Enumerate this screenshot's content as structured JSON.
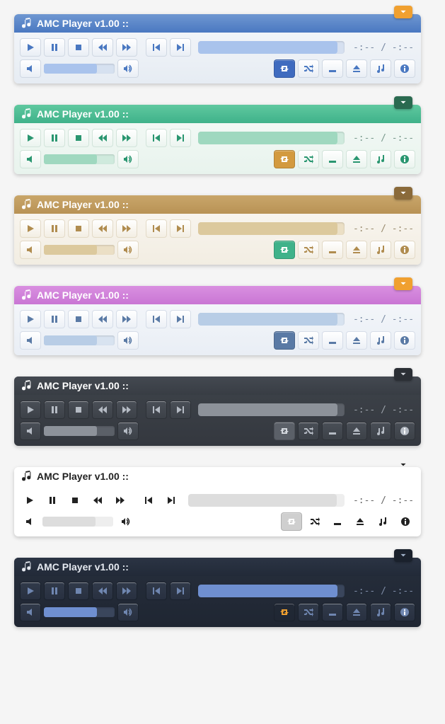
{
  "playerTitle": "AMC Player v1.00 ::",
  "time": "-:-- / -:--",
  "progressPercent": 95,
  "volumePercent": 75,
  "themes": [
    {
      "name": "blue",
      "titlebarBg": "linear-gradient(#6f97d1,#4a78c1)",
      "titlebarColor": "#ffffff",
      "bodyBg": "linear-gradient(#f5f7fa,#e6ecf3)",
      "btnBg": "linear-gradient(#ffffff,#e9eef5)",
      "btnBorder": "#d0d8e3",
      "iconColor": "#4a78c1",
      "progressBg": "#d6e0f0",
      "progressFill": "#a9c3ec",
      "volumeBg": "#d6e1f0",
      "volumeFill": "#a9c3ec",
      "timeColor": "#7a8aa3",
      "collapseBg": "#f0a030",
      "collapseIcon": "#ffffff",
      "repeatBg": "#3f6bbf",
      "repeatIcon": "#ffffff"
    },
    {
      "name": "green",
      "titlebarBg": "linear-gradient(#5fc89f,#3fb28a)",
      "titlebarColor": "#ffffff",
      "bodyBg": "linear-gradient(#f5faf7,#e8f3ed)",
      "btnBg": "linear-gradient(#ffffff,#ebf4ef)",
      "btnBorder": "#d2e4da",
      "iconColor": "#2a9670",
      "progressBg": "#cfeadd",
      "progressFill": "#9fd8bf",
      "volumeBg": "#cfeadd",
      "volumeFill": "#9fd8bf",
      "timeColor": "#7a9a8d",
      "collapseBg": "#2a6a50",
      "collapseIcon": "#ffffff",
      "repeatBg": "#d39a3f",
      "repeatIcon": "#ffffff"
    },
    {
      "name": "tan",
      "titlebarBg": "linear-gradient(#c9a66a,#b89255)",
      "titlebarColor": "#ffffff",
      "bodyBg": "linear-gradient(#faf7f2,#f2ede2)",
      "btnBg": "linear-gradient(#ffffff,#f3eee3)",
      "btnBorder": "#e3dac7",
      "iconColor": "#b08c4f",
      "progressBg": "#ebdfc5",
      "progressFill": "#dcc99d",
      "volumeBg": "#ebdfc5",
      "volumeFill": "#dcc99d",
      "timeColor": "#9a8c70",
      "collapseBg": "#8a6a3a",
      "collapseIcon": "#ffffff",
      "repeatBg": "#3fb28a",
      "repeatIcon": "#ffffff"
    },
    {
      "name": "purple",
      "titlebarBg": "linear-gradient(#d98fe0,#c976d4)",
      "titlebarColor": "#ffffff",
      "bodyBg": "linear-gradient(#f6f8fb,#e9eef5)",
      "btnBg": "linear-gradient(#ffffff,#ecf0f6)",
      "btnBorder": "#d6dde8",
      "iconColor": "#5a7aa5",
      "progressBg": "#d8e3f0",
      "progressFill": "#b8cde6",
      "volumeBg": "#d8e3f0",
      "volumeFill": "#b8cde6",
      "timeColor": "#7f8fa6",
      "collapseBg": "#f0a030",
      "collapseIcon": "#ffffff",
      "repeatBg": "#5a7aa5",
      "repeatIcon": "#ffffff"
    },
    {
      "name": "darkgrey",
      "titlebarBg": "linear-gradient(#444951,#383d44)",
      "titlebarColor": "#ffffff",
      "bodyBg": "linear-gradient(#3e434a,#34383f)",
      "btnBg": "linear-gradient(#4a4f57,#3c4148)",
      "btnBorder": "#2d3137",
      "iconColor": "#b5bbc4",
      "progressBg": "#5b6068",
      "progressFill": "#8d929a",
      "volumeBg": "#5b6068",
      "volumeFill": "#8d929a",
      "timeColor": "#9aa0a9",
      "collapseBg": "#2b2f35",
      "collapseIcon": "#cfd3d9",
      "repeatBg": "#5b6068",
      "repeatIcon": "#d4d8de"
    },
    {
      "name": "white",
      "titlebarBg": "#ffffff",
      "titlebarColor": "#222222",
      "bodyBg": "#ffffff",
      "btnBg": "transparent",
      "btnBorder": "transparent",
      "iconColor": "#222222",
      "progressBg": "#eeeeee",
      "progressFill": "#dddddd",
      "volumeBg": "#eeeeee",
      "volumeFill": "#dddddd",
      "timeColor": "#666666",
      "collapseBg": "transparent",
      "collapseIcon": "#222222",
      "repeatBg": "#cfcfcf",
      "repeatIcon": "#ffffff",
      "flat": true
    },
    {
      "name": "darkblue",
      "titlebarBg": "linear-gradient(#2b3444,#222a38)",
      "titlebarColor": "#e5e9f0",
      "bodyBg": "linear-gradient(#262e3c,#1f2632)",
      "btnBg": "linear-gradient(#313a4a,#283040)",
      "btnBorder": "#1a212c",
      "iconColor": "#6f86b0",
      "progressBg": "#3a465c",
      "progressFill": "#6f8fd0",
      "volumeBg": "#3a465c",
      "volumeFill": "#6f8fd0",
      "timeColor": "#7c8aa4",
      "collapseBg": "#1a212c",
      "collapseIcon": "#9fb0c8",
      "repeatBg": "transparent",
      "repeatIcon": "#f0a030",
      "flat": false
    }
  ],
  "icons": {
    "play": "play-icon",
    "pause": "pause-icon",
    "stop": "stop-icon",
    "rewind": "rewind-icon",
    "forward": "fast-forward-icon",
    "prev": "previous-track-icon",
    "next": "next-track-icon",
    "volDown": "volume-down-icon",
    "volUp": "volume-up-icon",
    "repeat": "repeat-icon",
    "shuffle": "shuffle-icon",
    "minimize": "minimize-icon",
    "eject": "eject-icon",
    "playlist": "playlist-icon",
    "info": "info-icon",
    "collapse": "chevron-down-icon",
    "music": "music-note-icon"
  }
}
